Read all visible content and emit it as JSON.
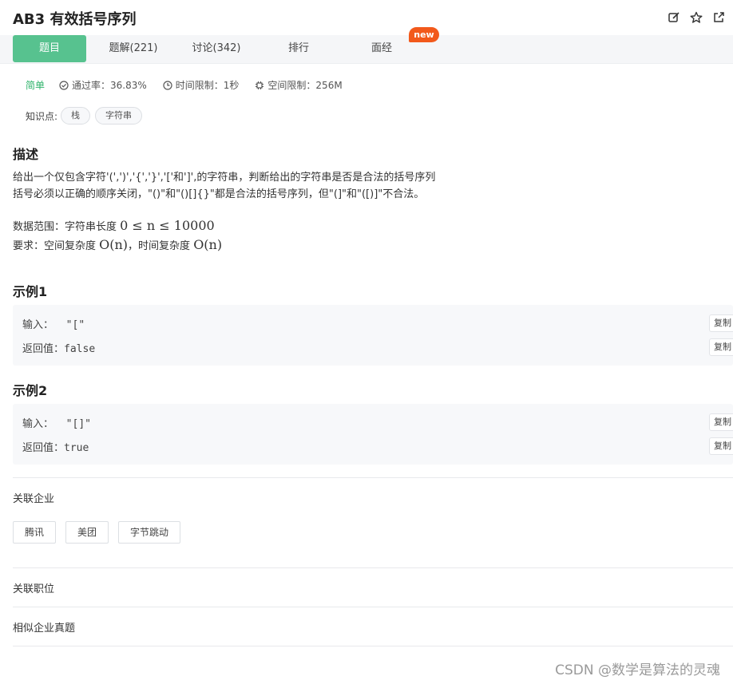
{
  "problem": {
    "title": "AB3  有效括号序列"
  },
  "tabs": [
    {
      "label": "题目"
    },
    {
      "label": "题解(221)"
    },
    {
      "label": "讨论(342)"
    },
    {
      "label": "排行"
    },
    {
      "label": "面经"
    }
  ],
  "new_badge": "new",
  "meta": {
    "difficulty": "简单",
    "pass_rate": "通过率：36.83%",
    "time_limit": "时间限制：1秒",
    "memory_limit": "空间限制：256M"
  },
  "knowledge": {
    "label": "知识点:",
    "tags": [
      "栈",
      "字符串"
    ]
  },
  "description": {
    "heading": "描述",
    "line1": "给出一个仅包含字符'(',')','{','}','['和']',的字符串，判断给出的字符串是否是合法的括号序列",
    "line2": "括号必须以正确的顺序关闭，\"()\"和\"()[]{}\"都是合法的括号序列，但\"(]\"和\"([)]\"不合法。",
    "range_prefix": "数据范围：字符串长度 ",
    "range_math": "0 ≤ n ≤ 10000",
    "req_prefix": "要求：空间复杂度 ",
    "req_space": "O(n)",
    "req_mid": "，时间复杂度 ",
    "req_time": "O(n)"
  },
  "examples": [
    {
      "heading": "示例1",
      "input_label": "输入：",
      "input_value": "\"[\"",
      "output_label": "返回值：",
      "output_value": "false",
      "copy_label": "复制"
    },
    {
      "heading": "示例2",
      "input_label": "输入：",
      "input_value": "\"[]\"",
      "output_label": "返回值：",
      "output_value": "true",
      "copy_label": "复制"
    }
  ],
  "related": {
    "companies_label": "关联企业",
    "companies": [
      "腾讯",
      "美团",
      "字节跳动"
    ],
    "positions_label": "关联职位",
    "similar_label": "相似企业真题"
  },
  "watermark": "CSDN @数学是算法的灵魂",
  "colors": {
    "accent": "#57c28f",
    "badge": "#f2591b",
    "easy": "#2fb36b"
  }
}
